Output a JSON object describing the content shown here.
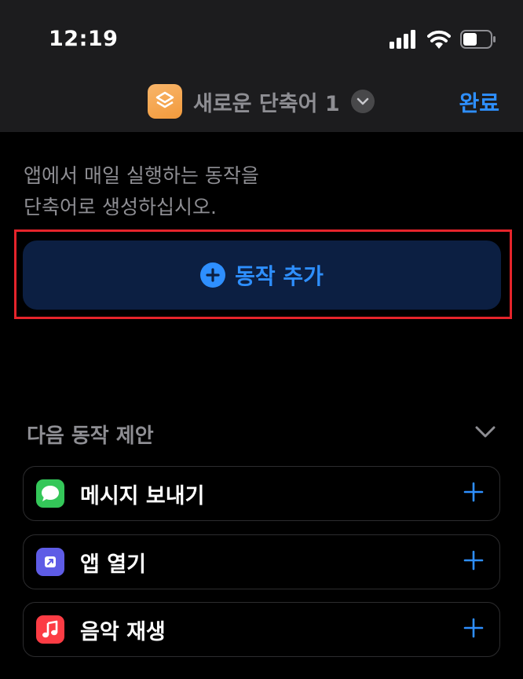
{
  "status_bar": {
    "time": "12:19"
  },
  "nav": {
    "title": "새로운 단축어 1",
    "done_label": "완료"
  },
  "description": {
    "line1": "앱에서 매일 실행하는 동작을",
    "line2": "단축어로 생성하십시오."
  },
  "add_action": {
    "label": "동작 추가"
  },
  "suggestions": {
    "title": "다음 동작 제안",
    "items": [
      {
        "label": "메시지 보내기",
        "icon": "messages-icon",
        "color": "#34c759"
      },
      {
        "label": "앱 열기",
        "icon": "open-app-icon",
        "color": "#5e5ce6"
      },
      {
        "label": "음악 재생",
        "icon": "music-icon",
        "color": "#fc3c44"
      }
    ]
  },
  "colors": {
    "accent": "#2e8fff",
    "highlight": "#e5242b",
    "bar_background": "#1c1c1e"
  }
}
